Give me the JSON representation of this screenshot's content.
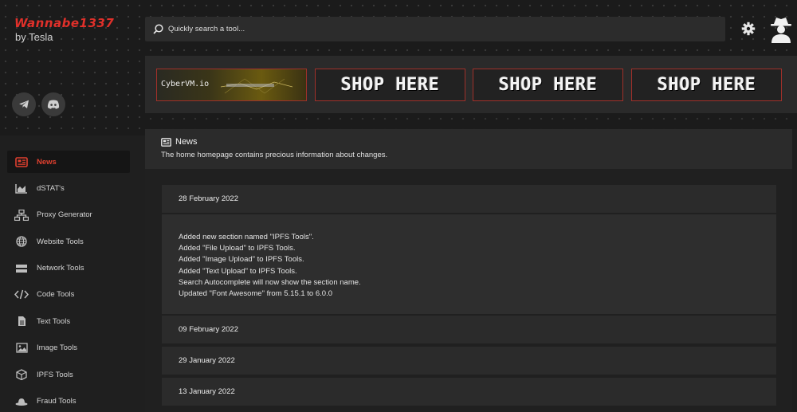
{
  "brand": {
    "logo_text": "Wannabe1337",
    "byline": "by Tesla"
  },
  "social": [
    {
      "name": "telegram-icon"
    },
    {
      "name": "discord-icon"
    }
  ],
  "sidebar": {
    "items": [
      {
        "label": "News",
        "icon": "newspaper-icon",
        "active": true
      },
      {
        "label": "dSTAT's",
        "icon": "area-chart-icon"
      },
      {
        "label": "Proxy Generator",
        "icon": "network-icon"
      },
      {
        "label": "Website Tools",
        "icon": "globe-icon"
      },
      {
        "label": "Network Tools",
        "icon": "server-icon"
      },
      {
        "label": "Code Tools",
        "icon": "code-icon"
      },
      {
        "label": "Text Tools",
        "icon": "file-text-icon"
      },
      {
        "label": "Image Tools",
        "icon": "image-icon"
      },
      {
        "label": "IPFS Tools",
        "icon": "cube-icon"
      },
      {
        "label": "Fraud Tools",
        "icon": "hat-icon"
      }
    ]
  },
  "search": {
    "placeholder": "Quickly search a tool..."
  },
  "banners": {
    "cyber_label": "CyberVM.io",
    "shop_label": "SHOP HERE"
  },
  "news": {
    "title": "News",
    "subtitle": "The home homepage contains precious information about changes.",
    "entries": [
      {
        "date": "28 February 2022",
        "lines": [
          "Added new section named \"IPFS Tools\".",
          "Added \"File Upload\" to IPFS Tools.",
          "Added \"Image Upload\" to IPFS Tools.",
          "Added \"Text Upload\" to IPFS Tools.",
          "Search Autocomplete will now show the section name.",
          "Updated \"Font Awesome\" from 5.15.1 to 6.0.0"
        ]
      },
      {
        "date": "09 February 2022"
      },
      {
        "date": "29 January 2022"
      },
      {
        "date": "13 January 2022"
      }
    ]
  },
  "colors": {
    "accent": "#e0302a",
    "background": "#1e1e1e",
    "panel": "#2b2b2b"
  }
}
